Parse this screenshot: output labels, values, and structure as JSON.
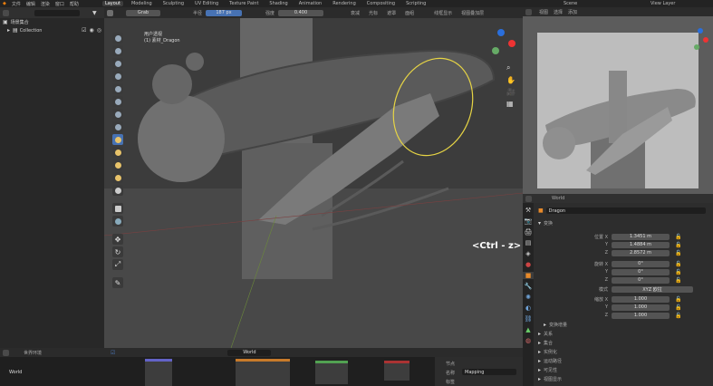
{
  "menu": {
    "items": [
      "文件",
      "编辑",
      "渲染",
      "窗口",
      "帮助"
    ],
    "workspaces": [
      "Layout",
      "Modeling",
      "Sculpting",
      "UV Editing",
      "Texture Paint",
      "Shading",
      "Animation",
      "Rendering",
      "Compositing",
      "Scripting"
    ],
    "active_workspace": "Layout",
    "scene": "Scene",
    "view_layer": "View Layer"
  },
  "outliner": {
    "header": "场景集合",
    "collection": "Collection"
  },
  "sculpt_header": {
    "brush": "Grab",
    "radius_label": "半径",
    "radius_value": "187 px",
    "strength_label": "强度",
    "strength_value": "0.400",
    "falloff": "衰减",
    "cursor": "光标",
    "mask": "遮罩",
    "face_sets": "面组",
    "sym_label": "线框显示",
    "viewport_options": "视图叠加层"
  },
  "viewport": {
    "title": "用户透视",
    "object": "(1) 素材_Dragon",
    "key_hint": "<Ctrl - z>"
  },
  "properties": {
    "object_name": "World",
    "mesh_name": "Dragon",
    "section_transform": "变换",
    "location_label": "位置 X",
    "loc_x": "1.3451 m",
    "loc_y": "1.4884 m",
    "loc_z": "2.8572 m",
    "rotation_label": "旋转 X",
    "rot_x": "0°",
    "rot_y": "0°",
    "rot_z": "0°",
    "mode_label": "模式",
    "mode_value": "XYZ 欧拉",
    "scale_label": "缩放 X",
    "scale_x": "1.000",
    "scale_y": "1.000",
    "scale_z": "1.000",
    "y": "Y",
    "z": "Z",
    "delta": "变换增量",
    "relations": "关系",
    "collections": "集合",
    "instancing": "实例化",
    "motion_paths": "运动路径",
    "visibility": "可见性",
    "viewport_display": "视图显示"
  },
  "node_editor": {
    "header": "世界环境",
    "node_tree": "World",
    "panel_label": "节点",
    "name_label": "名称",
    "name_value": "Mapping",
    "label_label": "标签"
  },
  "viewport2": {
    "header_items": [
      "视图",
      "选择",
      "添加"
    ]
  },
  "colors": {
    "accent": "#4772b3",
    "grid_line": "#3a3a3a",
    "brush_circle": "#e6d445"
  }
}
